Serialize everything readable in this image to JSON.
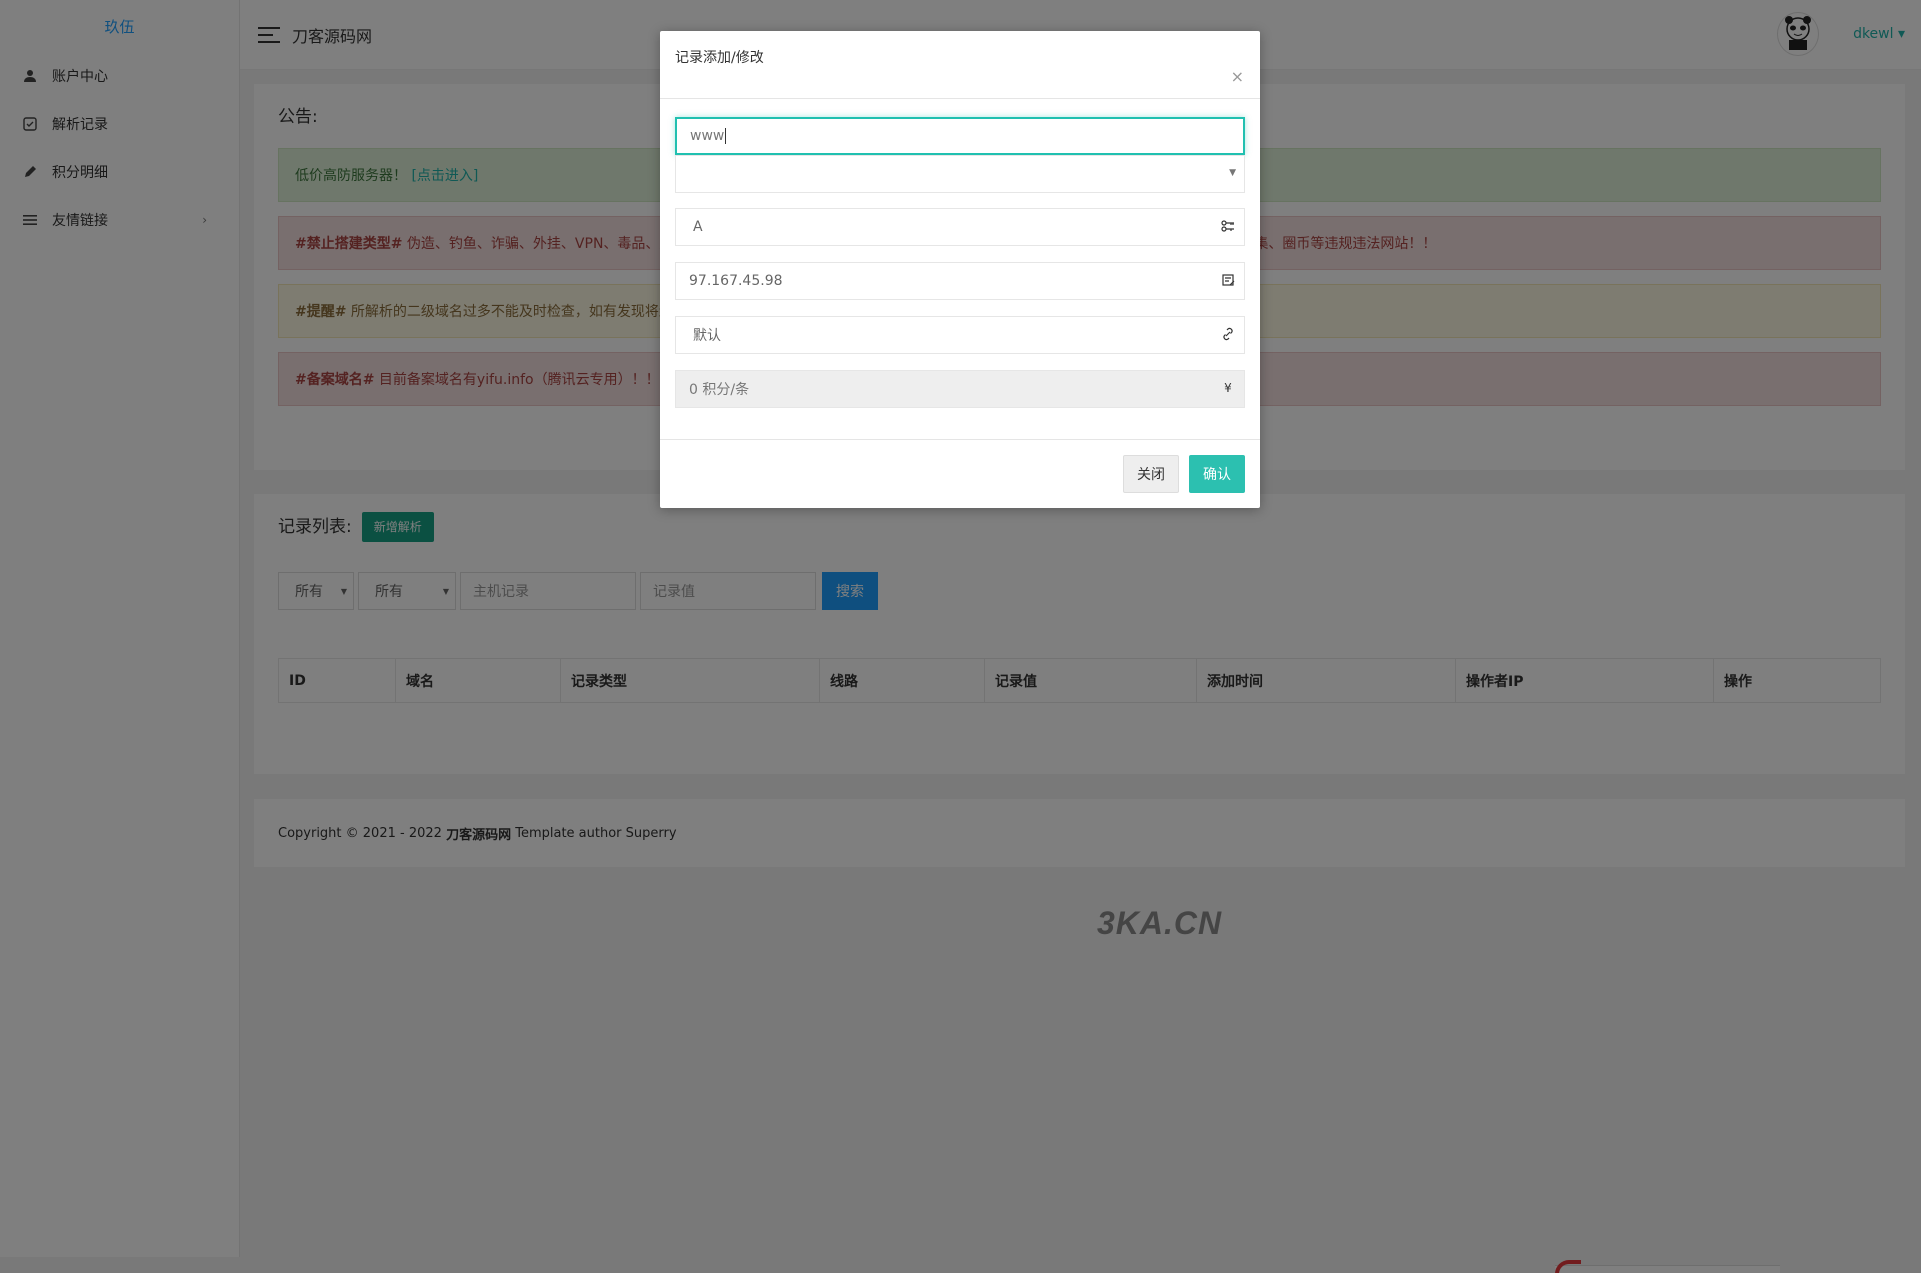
{
  "sidebar": {
    "logo_alt": "玖伍",
    "items": [
      {
        "label": "账户中心",
        "icon": "user-icon"
      },
      {
        "label": "解析记录",
        "icon": "records-icon"
      },
      {
        "label": "积分明细",
        "icon": "pen-icon"
      },
      {
        "label": "友情链接",
        "icon": "list-icon",
        "chevron": "›"
      }
    ]
  },
  "header": {
    "site_title": "刀客源码网",
    "username": "dkewl ▾"
  },
  "notice": {
    "title": "公告:",
    "alerts": [
      {
        "prefix": "低价高防服务器！",
        "link": "[点击进入]",
        "color": "green"
      },
      {
        "prefix": "#禁止搭建类型#",
        "text": " 伪造、钓鱼、诈骗、外挂、VPN、毒品、赌",
        "tail": "息收集、圈币等违规违法网站！！",
        "color": "red"
      },
      {
        "prefix": "#提醒#",
        "text": " 所解析的二级域名过多不能及时检查，如有发现将封",
        "color": "yellow"
      },
      {
        "prefix": "#备案域名#",
        "text": " 目前备案域名有yifu.info（腾讯云专用）！！",
        "color": "red"
      }
    ]
  },
  "records": {
    "title": "记录列表:",
    "add_button": "新增解析",
    "filter_1": "所有",
    "filter_2": "所有",
    "host_placeholder": "主机记录",
    "value_placeholder": "记录值",
    "search_button": "搜索",
    "columns": [
      "ID",
      "域名",
      "记录类型",
      "线路",
      "记录值",
      "添加时间",
      "操作者IP",
      "操作"
    ]
  },
  "footer": {
    "prefix": "Copyright © 2021 - 2022 ",
    "brand": "刀客源码网",
    "suffix": " Template author Superry"
  },
  "watermark": "3KA.CN",
  "modal": {
    "title": "记录添加/修改",
    "close_symbol": "×",
    "host_value": "www",
    "domain_value": "",
    "type_value": "A",
    "record_value": "97.167.45.98",
    "line_value": "默认",
    "cost_value": "0 积分/条",
    "cost_symbol": "¥",
    "close_button": "关闭",
    "confirm_button": "确认"
  },
  "colors": {
    "accent": "#2cc0b0",
    "search": "#1e9fff",
    "add": "#16a085"
  }
}
